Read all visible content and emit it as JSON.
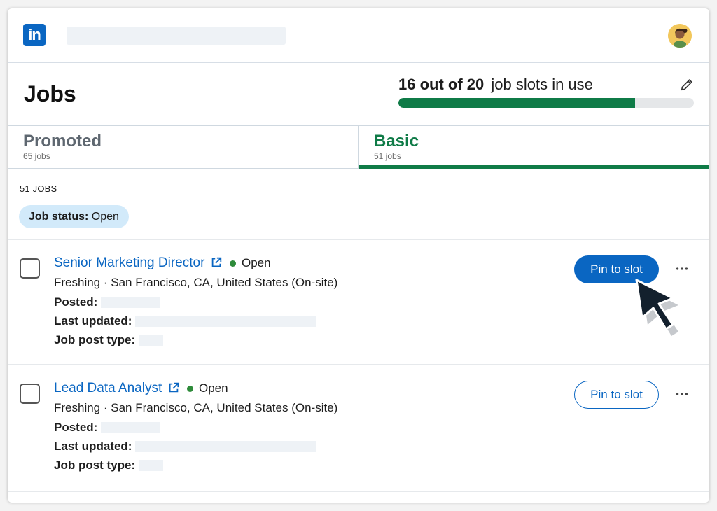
{
  "brand": {
    "logo_text": "in",
    "color": "#0a66c2"
  },
  "header": {
    "title": "Jobs"
  },
  "slots": {
    "count_text": "16 out of 20",
    "label": "job slots in use",
    "used": 16,
    "total": 20,
    "fill_color": "#0f7b47"
  },
  "tabs": [
    {
      "name": "Promoted",
      "count": "65 jobs",
      "active": false
    },
    {
      "name": "Basic",
      "count": "51 jobs",
      "active": true
    }
  ],
  "list": {
    "count_label": "51 JOBS",
    "filter": {
      "label": "Job status:",
      "value": "Open"
    }
  },
  "jobs": [
    {
      "title": "Senior Marketing Director",
      "status": "Open",
      "company_location": "Freshing · San Francisco, CA, United States (On-site)",
      "posted_label": "Posted:",
      "updated_label": "Last updated:",
      "type_label": "Job post type:",
      "action": "Pin to slot",
      "action_style": "primary"
    },
    {
      "title": "Lead Data Analyst",
      "status": "Open",
      "company_location": "Freshing · San Francisco, CA, United States (On-site)",
      "posted_label": "Posted:",
      "updated_label": "Last updated:",
      "type_label": "Job post type:",
      "action": "Pin to slot",
      "action_style": "secondary"
    }
  ],
  "icons": {
    "edit": "pencil-icon",
    "external": "external-link-icon",
    "more": "ellipsis-icon",
    "cursor": "mouse-pointer-icon"
  }
}
